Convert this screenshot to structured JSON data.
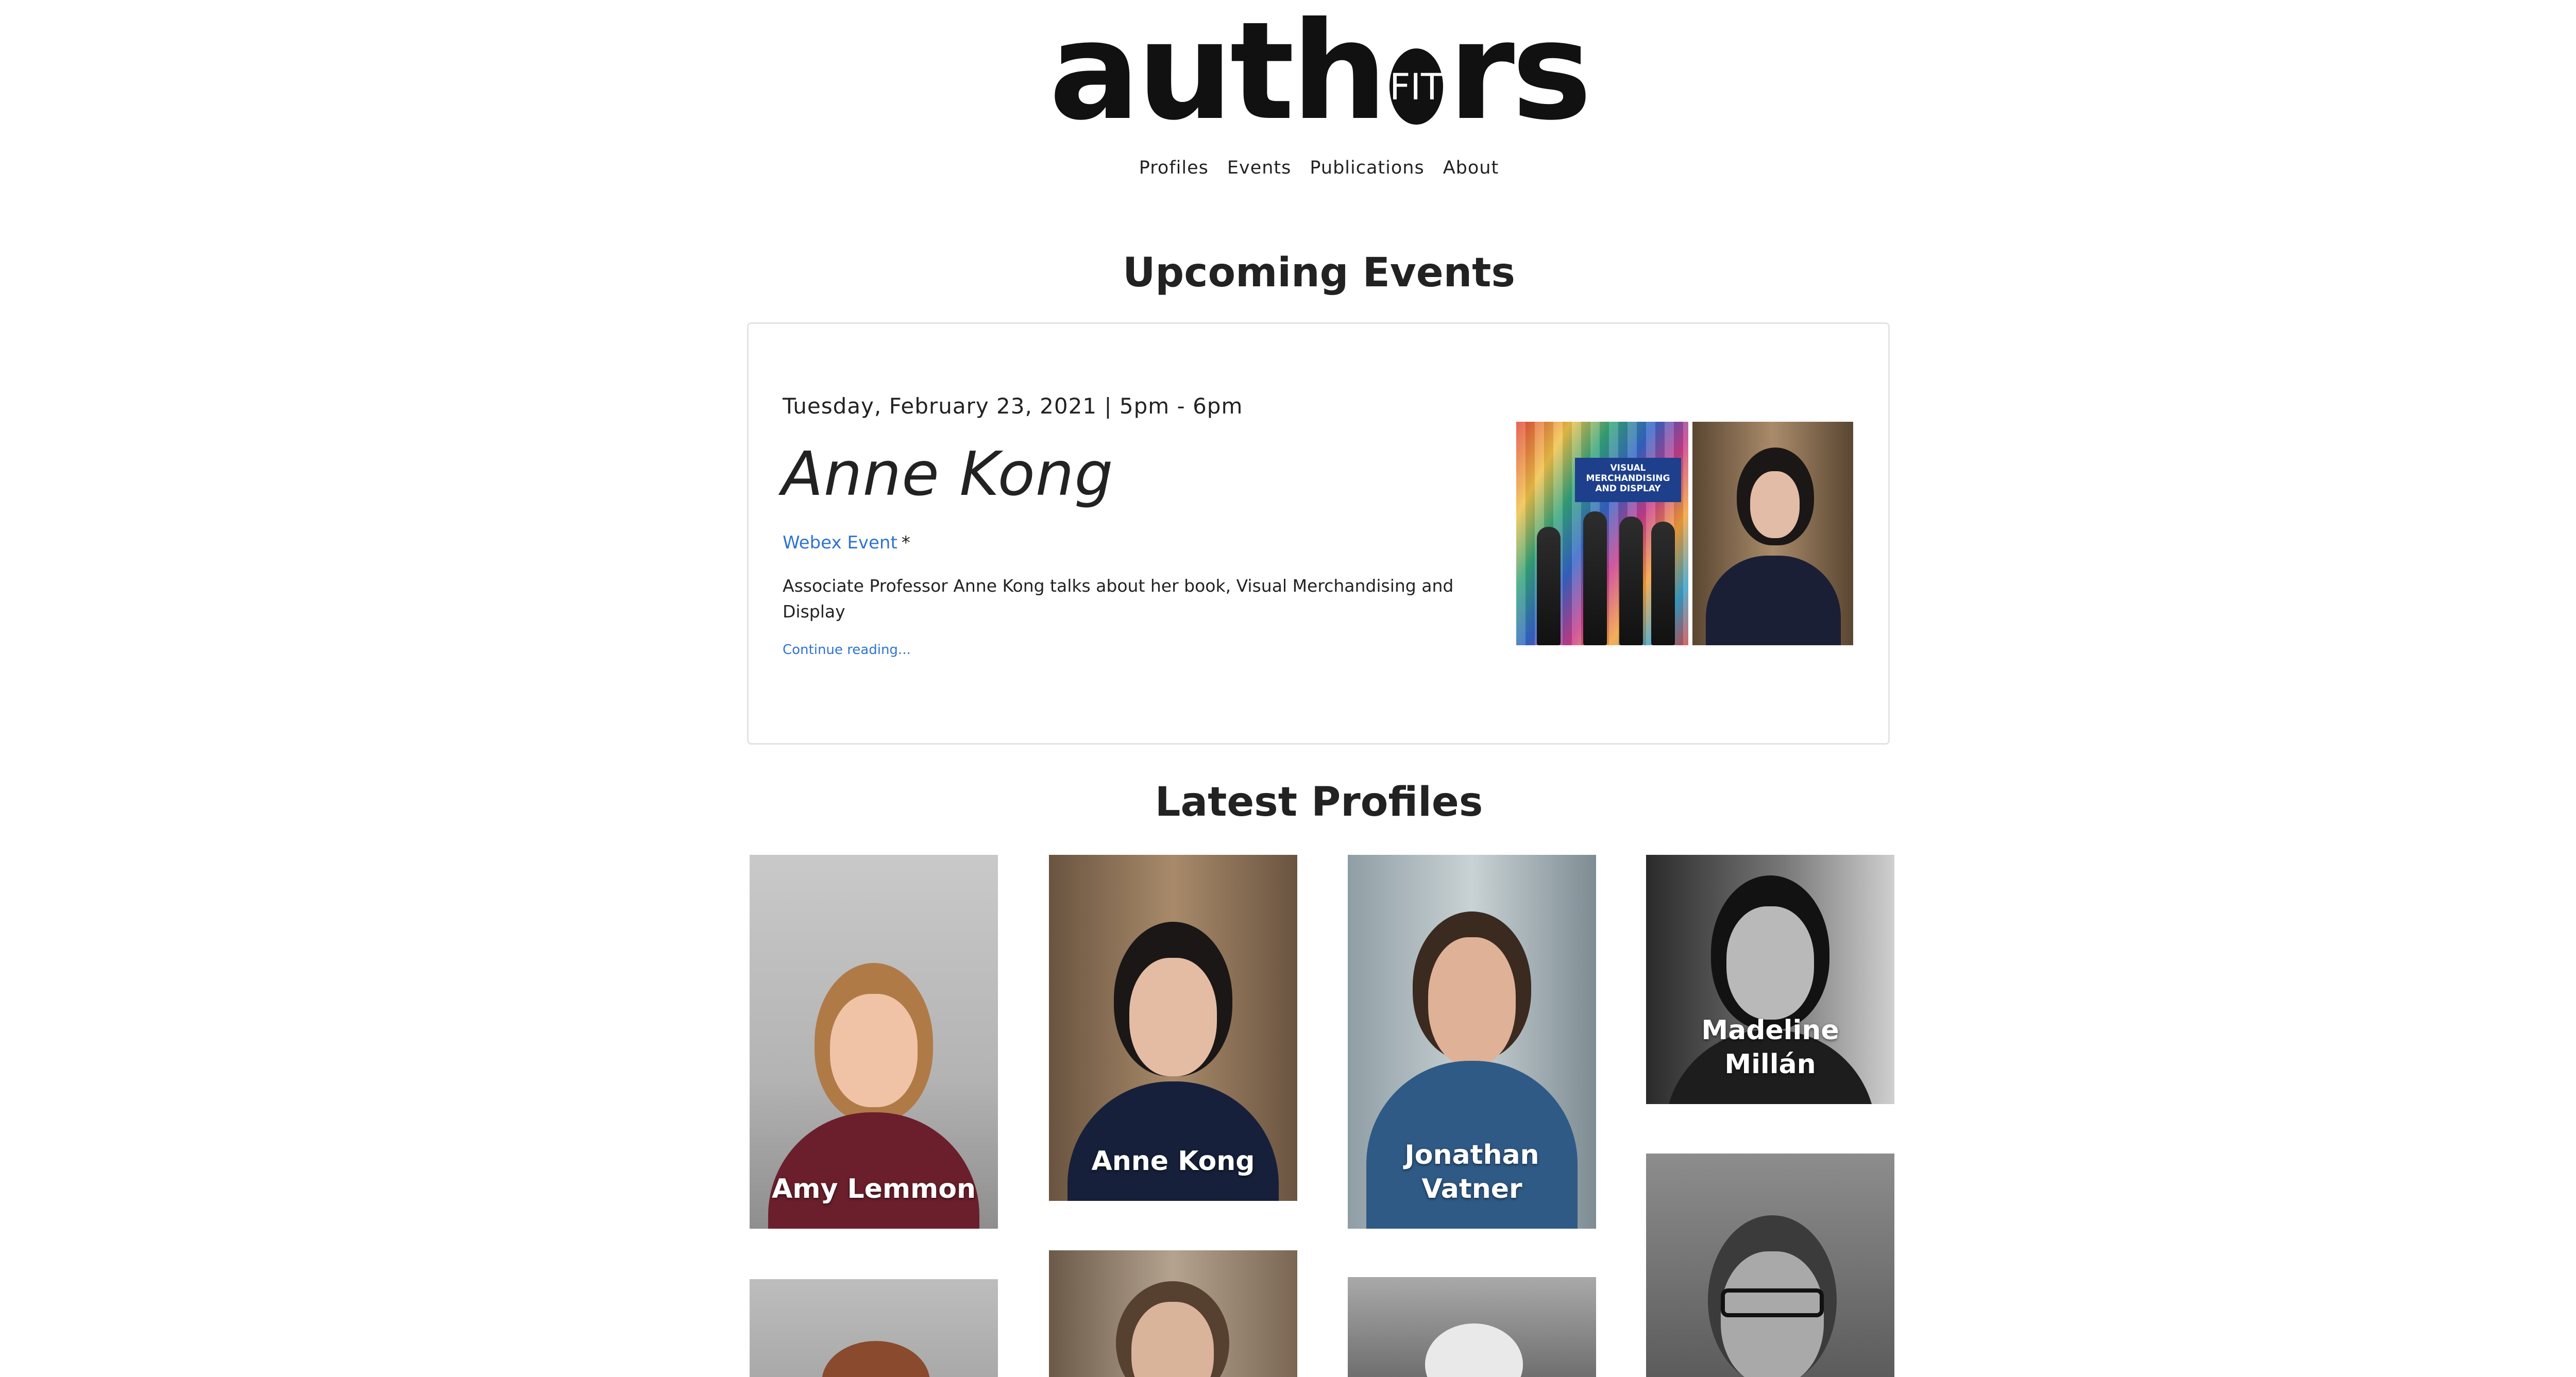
{
  "site": {
    "logo": {
      "prefix": "auth",
      "circle_text": "FIT",
      "suffix": "rs"
    },
    "nav": [
      "Profiles",
      "Events",
      "Publications",
      "About"
    ]
  },
  "events": {
    "title": "Upcoming Events",
    "items": [
      {
        "date": "Tuesday, February 23, 2021 | 5pm - 6pm",
        "name": "Anne Kong",
        "location": "Webex Event",
        "location_suffix": "*",
        "description": "Associate Professor Anne Kong talks about her book, Visual Merchandising and Display",
        "more": "Continue reading...",
        "book_cover_text": "VISUAL MERCHANDISING AND DISPLAY"
      }
    ]
  },
  "profiles": {
    "title": "Latest Profiles",
    "items": [
      {
        "name": "Amy Lemmon"
      },
      {
        "name": "Anne Kong"
      },
      {
        "name": "Jonathan Vatner"
      },
      {
        "name": "Madeline Millán"
      }
    ]
  },
  "colors": {
    "link": "#2f74d0",
    "text": "#222222",
    "border": "#e3e3e3"
  }
}
